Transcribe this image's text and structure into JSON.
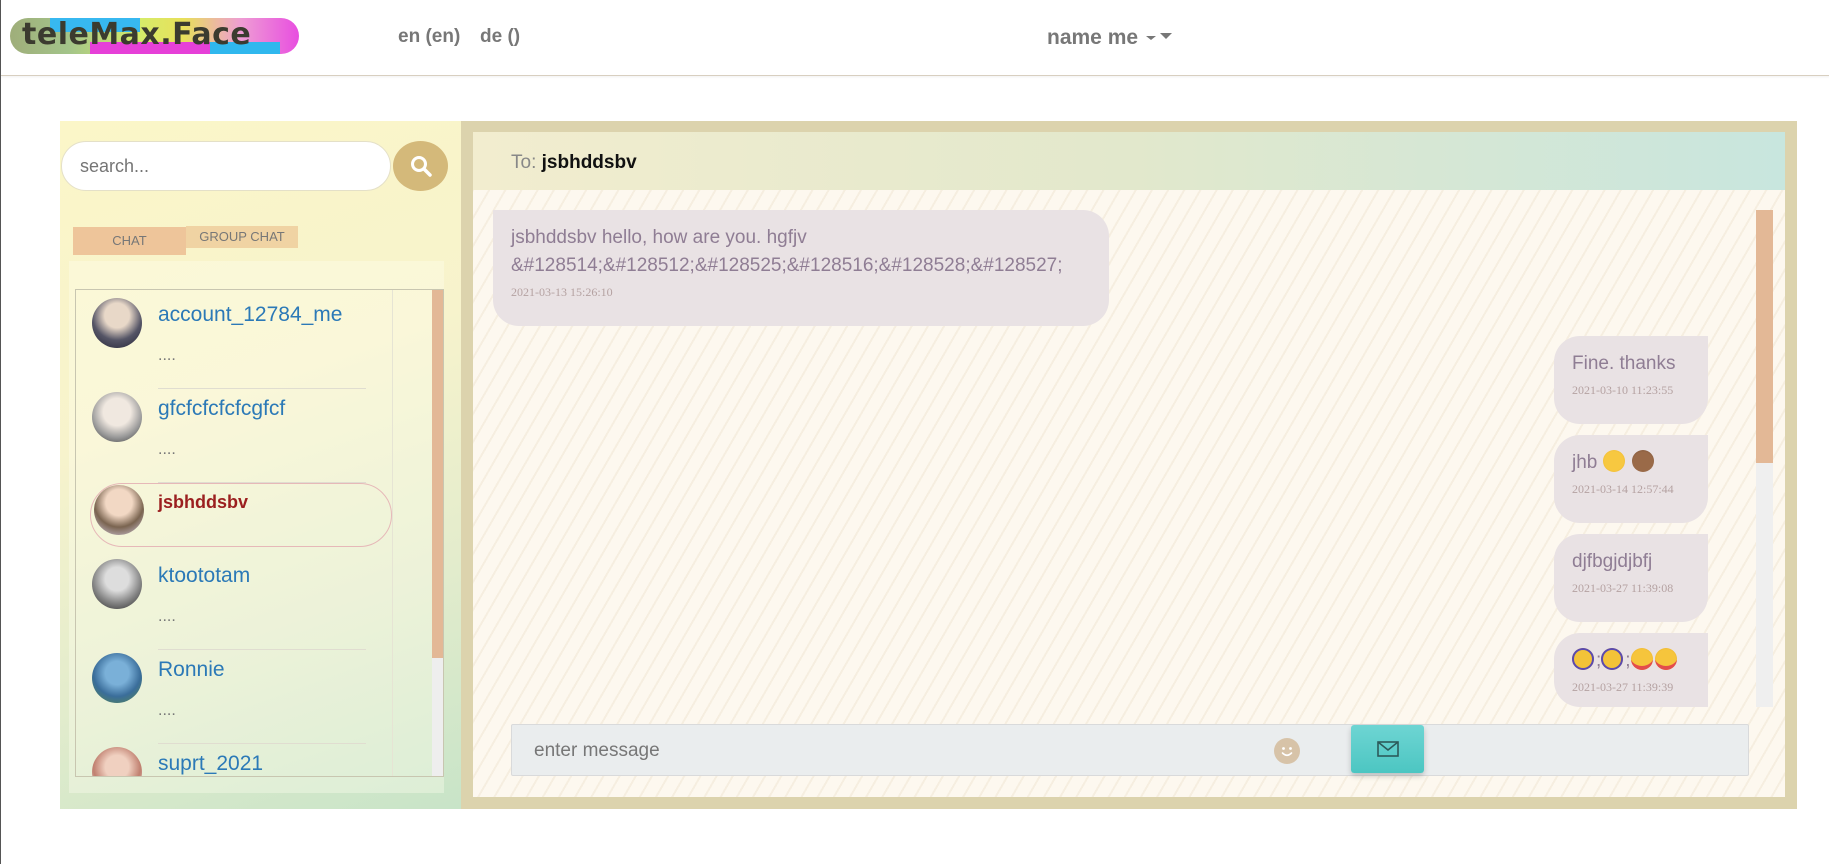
{
  "header": {
    "logo_text": "teleMax.Face",
    "languages": [
      "en (en)",
      "de ()"
    ],
    "user_name": "name me"
  },
  "sidebar": {
    "search_placeholder": "search...",
    "tabs": [
      {
        "label": "CHAT",
        "active": true
      },
      {
        "label": "GROUP CHAT",
        "active": false
      }
    ],
    "contacts": [
      {
        "name": "account_12784_me",
        "preview": "....",
        "active": false
      },
      {
        "name": "gfcfcfcfcfcgfcf",
        "preview": "....",
        "active": false
      },
      {
        "name": "jsbhddsbv",
        "preview": "",
        "active": true
      },
      {
        "name": "ktoototam",
        "preview": "....",
        "active": false
      },
      {
        "name": "Ronnie",
        "preview": "....",
        "active": false
      },
      {
        "name": "suprt_2021",
        "preview": "",
        "active": false
      }
    ]
  },
  "chat": {
    "to_label": "To:",
    "recipient": "jsbhddsbv",
    "messages": [
      {
        "direction": "in",
        "text_line1": "jsbhddsbv hello, how are you. hgfjv",
        "text_line2": "&#128514;&#128512;&#128525;&#128516;&#128528;&#128527;",
        "time": "2021-03-13 15:26:10"
      },
      {
        "direction": "out",
        "text": "Fine. thanks",
        "time": "2021-03-10 11:23:55"
      },
      {
        "direction": "out",
        "text": "jhb",
        "emojis": [
          "smiling-face-with-hearts",
          "bear-face"
        ],
        "time": "2021-03-14 12:57:44"
      },
      {
        "direction": "out",
        "text": "djfbgjdjbfj",
        "time": "2021-03-27 11:39:08"
      },
      {
        "direction": "out",
        "text": ";;",
        "emojis": [
          "face-with-monocle",
          "face-with-monocle",
          "star-struck",
          "star-struck"
        ],
        "time": "2021-03-27 11:39:39"
      }
    ],
    "composer_placeholder": "enter message"
  },
  "colors": {
    "accent_tan": "#d4b97a",
    "link_blue": "#2b79b7",
    "active_name": "#9b1f1f",
    "send_teal": "#4cc6c2",
    "bubble": "#e9e2e4"
  }
}
